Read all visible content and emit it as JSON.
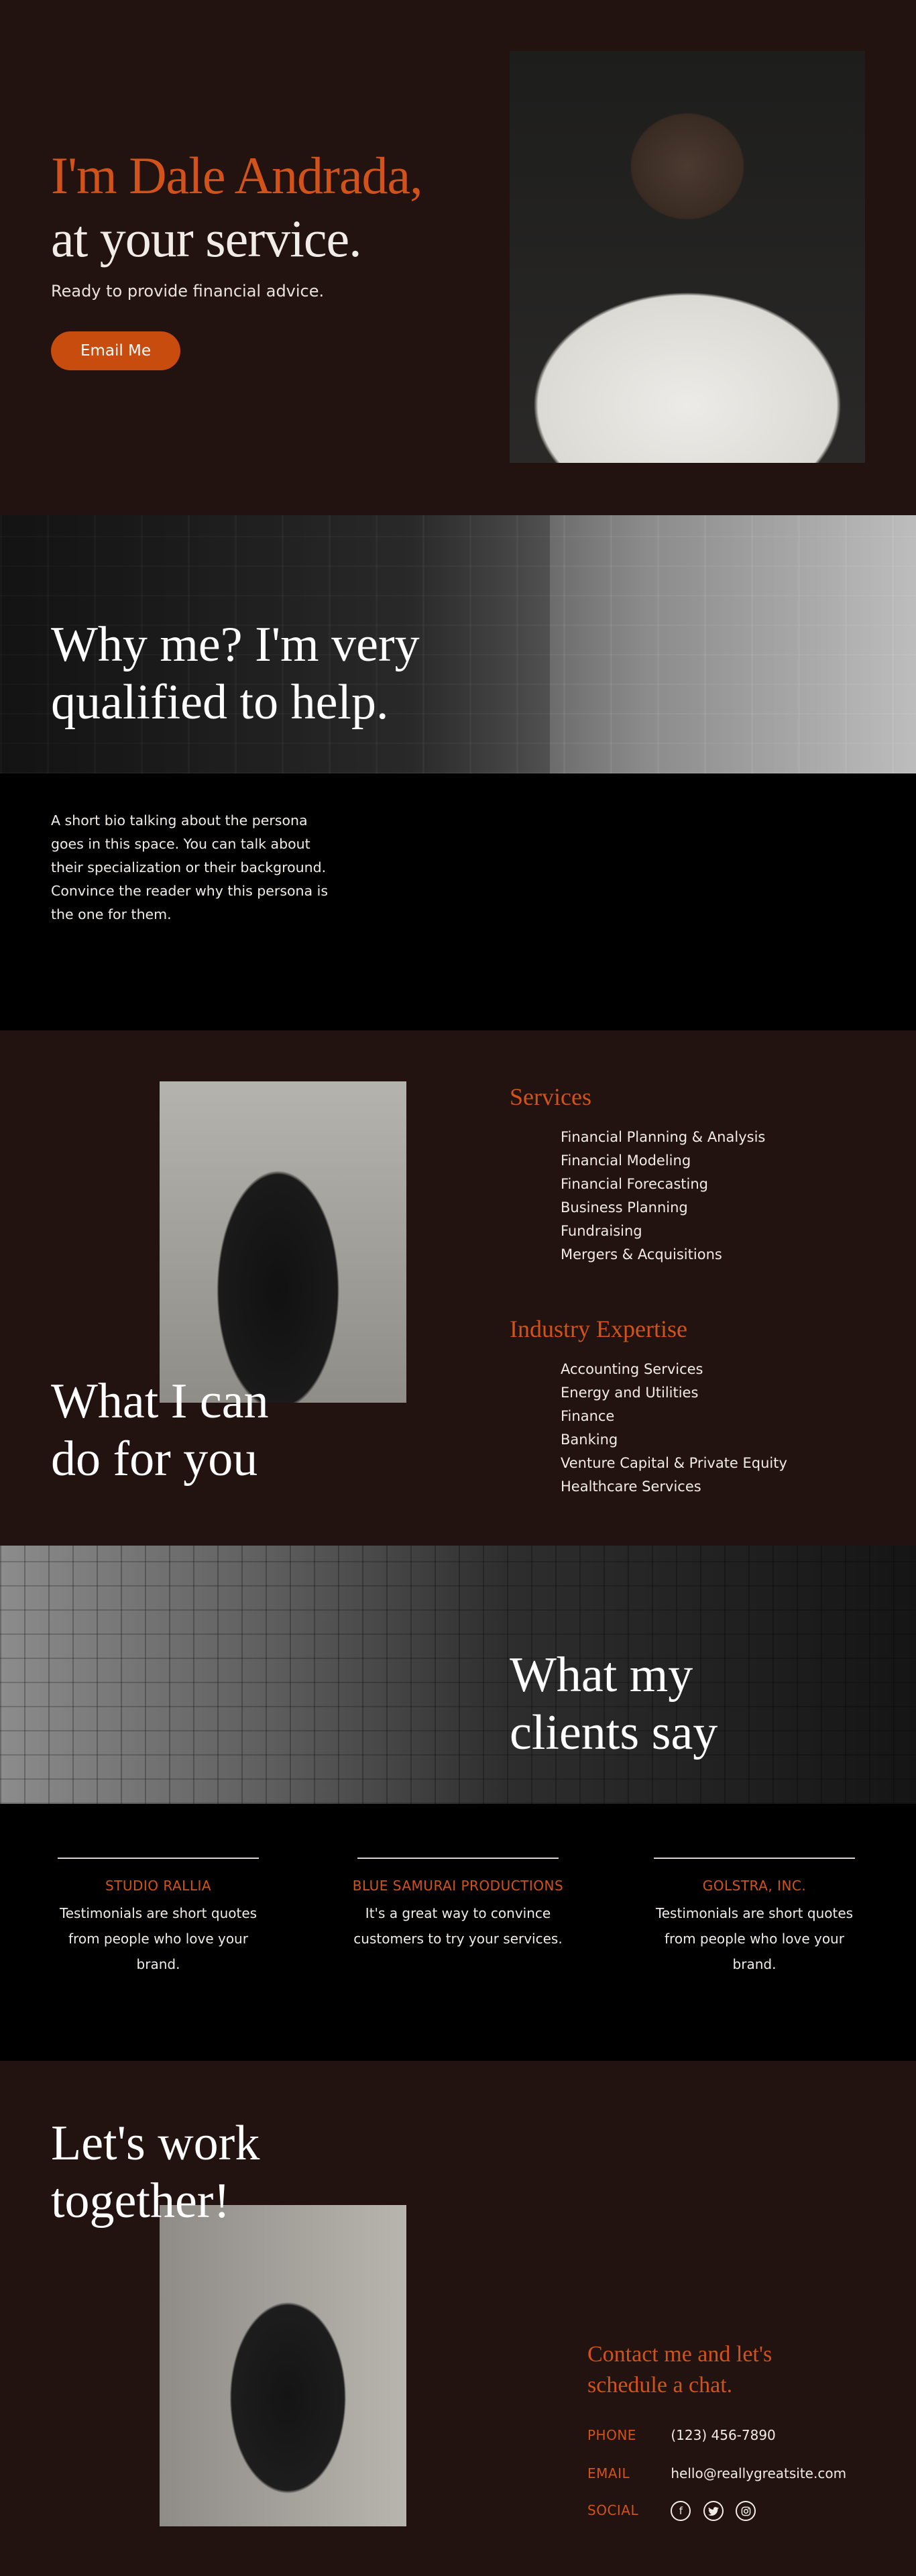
{
  "hero": {
    "title_line1": "I'm Dale Andrada,",
    "title_line2": "at your service.",
    "subtitle": "Ready to provide financial advice.",
    "button": "Email Me"
  },
  "why": {
    "title_line1": "Why me? I'm very",
    "title_line2": "qualified to help.",
    "bio": "A short bio talking about the persona goes in this space. You can talk about their specialization or their background. Convince the reader why this persona is the one for them."
  },
  "services": {
    "title_line1": "What I can",
    "title_line2": "do for you",
    "services_head": "Services",
    "services_items": [
      "Financial Planning & Analysis",
      "Financial Modeling",
      "Financial Forecasting",
      "Business Planning",
      "Fundraising",
      "Mergers & Acquisitions"
    ],
    "industry_head": "Industry Expertise",
    "industry_items": [
      "Accounting Services",
      "Energy and Utilities",
      "Finance",
      "Banking",
      "Venture Capital & Private Equity",
      "Healthcare Services"
    ]
  },
  "clients": {
    "title_line1": "What my",
    "title_line2": "clients say",
    "testimonials": [
      {
        "name": "STUDIO RALLIA",
        "line1": "Testimonials are short quotes",
        "line2": "from people who love your brand."
      },
      {
        "name": "BLUE SAMURAI PRODUCTIONS",
        "line1": "It's a great way to convince",
        "line2": "customers to try your services."
      },
      {
        "name": "GOLSTRA, INC.",
        "line1": "Testimonials are short quotes",
        "line2": "from people who love your brand."
      }
    ]
  },
  "contact": {
    "title_line1": "Let's work",
    "title_line2": "together!",
    "heading": "Contact me and let's schedule a chat.",
    "phone_label": "PHONE",
    "phone": "(123) 456-7890",
    "email_label": "EMAIL",
    "email": "hello@reallygreatsite.com",
    "social_label": "SOCIAL",
    "social_icons": [
      "facebook-icon",
      "twitter-icon",
      "instagram-icon"
    ]
  },
  "colors": {
    "accent": "#d1531a",
    "background": "#221210",
    "black": "#000000",
    "button": "#c94c0f"
  }
}
